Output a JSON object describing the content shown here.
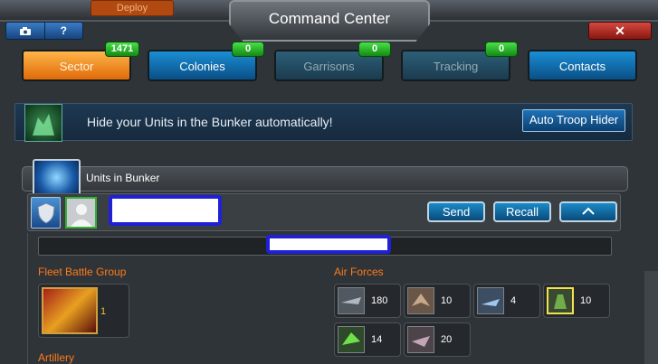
{
  "window": {
    "title": "Command Center",
    "close_label": "✕",
    "camera_icon": "camera-icon",
    "help_label": "?",
    "background_button": "Deploy"
  },
  "tabs": [
    {
      "label": "Sector",
      "count": "1471",
      "state": "selected"
    },
    {
      "label": "Colonies",
      "count": "0",
      "state": "normal"
    },
    {
      "label": "Garrisons",
      "count": "0",
      "state": "disabled"
    },
    {
      "label": "Tracking",
      "count": "0",
      "state": "disabled"
    },
    {
      "label": "Contacts",
      "count": "",
      "state": "normal"
    }
  ],
  "banner": {
    "text": "Hide your Units in the Bunker automatically!",
    "button": "Auto Troop Hider",
    "icon": "troop-icon"
  },
  "bunker": {
    "label": "Units in Bunker",
    "icon": "bunker-icon"
  },
  "controls": {
    "send": "Send",
    "recall": "Recall",
    "collapse_icon": "chevron-up-icon"
  },
  "sections": {
    "fleet": {
      "title": "Fleet Battle Group",
      "units": [
        {
          "count": "1",
          "icon": "fleet-ship-icon"
        }
      ]
    },
    "air": {
      "title": "Air Forces",
      "units": [
        {
          "count": "180",
          "icon": "fighter-jet-icon"
        },
        {
          "count": "10",
          "icon": "bomber-icon"
        },
        {
          "count": "4",
          "icon": "gunship-icon"
        },
        {
          "count": "10",
          "icon": "mech-aircraft-icon"
        },
        {
          "count": "14",
          "icon": "green-jet-icon"
        },
        {
          "count": "20",
          "icon": "drone-icon"
        }
      ]
    },
    "artillery": {
      "title": "Artillery"
    }
  },
  "colors": {
    "accent_orange": "#ff7a1a",
    "tab_blue": "#1a8ed4",
    "badge_green": "#30b830",
    "close_red": "#c43a30"
  }
}
